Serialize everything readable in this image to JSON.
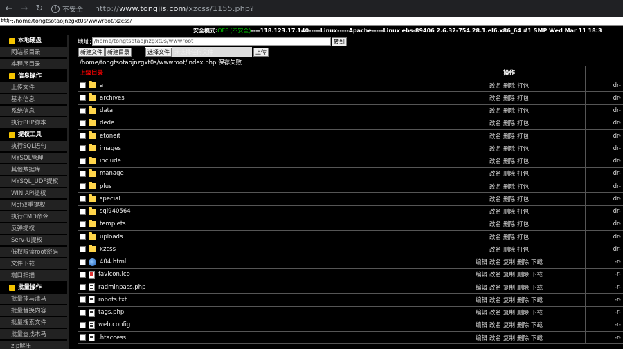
{
  "browser": {
    "insecure_label": "不安全",
    "url_prefix": "http://",
    "url_host": "www.tongjis.com",
    "url_path": "/xzcss/1155.php?"
  },
  "addrstrip": {
    "label": "地址:",
    "value": "/home/tongtsotaojnzgxt0s/wwwroot/xzcss/"
  },
  "infobar": {
    "safe_label": "安全模式:",
    "safe_value": "OFF (不安全)",
    "server_info": "----118.123.17.140-----Linux-----Apache-----Linux ebs-89406 2.6.32-754.28.1.el6.x86_64 #1 SMP Wed Mar 11 18:3"
  },
  "sidebar": {
    "sections": [
      {
        "title": "本地硬盘",
        "items": [
          "网站根目录",
          "本程序目录"
        ]
      },
      {
        "title": "信息操作",
        "items": [
          "上传文件",
          "基本信息",
          "系统信息",
          "执行PHP脚本"
        ]
      },
      {
        "title": "提权工具",
        "items": [
          "执行SQL语句",
          "MYSQL管理",
          "其他数据库",
          "MYSQL_UDF提权",
          "WIN API提权",
          "Mof双重提权",
          "执行CMD命令",
          "反弹提权",
          "Serv-U提权",
          "低权限读root密码",
          "文件下载",
          "端口扫描"
        ]
      },
      {
        "title": "批量操作",
        "items": [
          "批量挂马清马",
          "批量替换内容",
          "批量搜索文件",
          "批量查找木马",
          "zip解压"
        ]
      }
    ]
  },
  "controls": {
    "addr_label": "地址:",
    "addr_value": "/home/tongtsotaojnzgxt0s/wwwroot",
    "goto_label": "转到",
    "new_file_label": "新建文件",
    "new_dir_label": "新建目录",
    "choose_file_label": "选择文件",
    "no_file_label": "未选择任何文件",
    "upload_label": "上传",
    "status_path": "/home/tongtsotaojnzgxt0s/wwwroot/index.php 保存失败"
  },
  "table": {
    "parent_label": "上级目录",
    "ops_header": "操作",
    "dir_ops": [
      "改名",
      "删除",
      "打包"
    ],
    "file_ops": [
      "编辑",
      "改名",
      "复制",
      "删除",
      "下载"
    ],
    "dir_perm": "dr-",
    "file_perm": "-r-",
    "rows": [
      {
        "name": "a",
        "kind": "folder"
      },
      {
        "name": "archives",
        "kind": "folder"
      },
      {
        "name": "data",
        "kind": "folder"
      },
      {
        "name": "dede",
        "kind": "folder"
      },
      {
        "name": "etoneit",
        "kind": "folder"
      },
      {
        "name": "images",
        "kind": "folder"
      },
      {
        "name": "include",
        "kind": "folder"
      },
      {
        "name": "manage",
        "kind": "folder"
      },
      {
        "name": "plus",
        "kind": "folder"
      },
      {
        "name": "special",
        "kind": "folder"
      },
      {
        "name": "sql940564",
        "kind": "folder"
      },
      {
        "name": "templets",
        "kind": "folder"
      },
      {
        "name": "uploads",
        "kind": "folder"
      },
      {
        "name": "xzcss",
        "kind": "folder"
      },
      {
        "name": "404.html",
        "kind": "web"
      },
      {
        "name": "favicon.ico",
        "kind": "ico"
      },
      {
        "name": "radminpass.php",
        "kind": "file"
      },
      {
        "name": "robots.txt",
        "kind": "file"
      },
      {
        "name": "tags.php",
        "kind": "file"
      },
      {
        "name": "web.config",
        "kind": "file"
      },
      {
        "name": ".htaccess",
        "kind": "file"
      }
    ]
  }
}
